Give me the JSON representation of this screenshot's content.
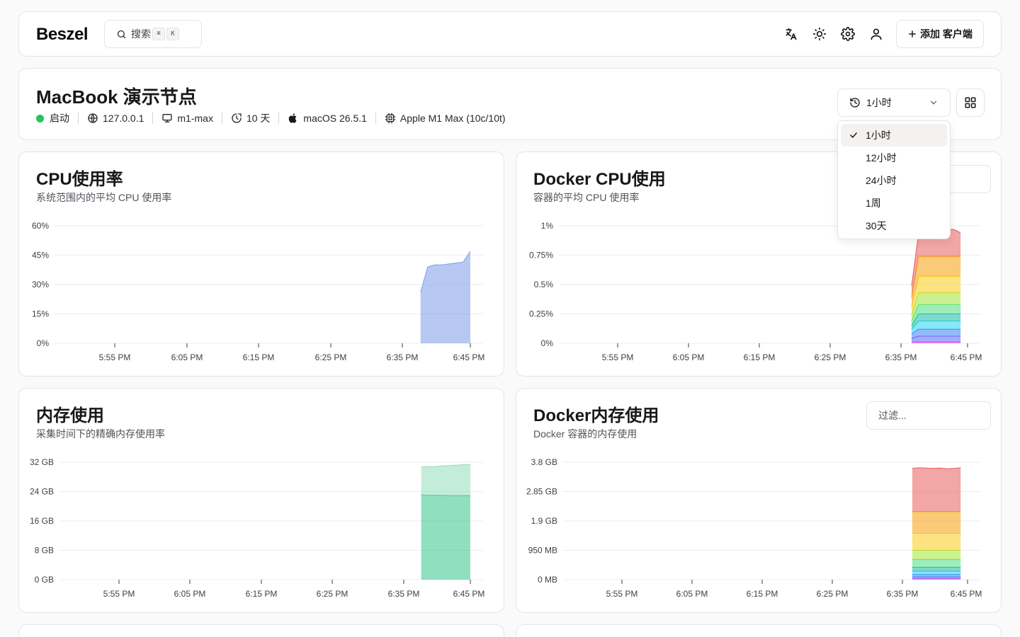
{
  "header": {
    "logo": "Beszel",
    "search_label": "搜索",
    "search_kbd": [
      "⌘",
      "K"
    ],
    "add_client_label": "添加 客户端",
    "icons": [
      "translate-icon",
      "sun-icon",
      "gear-icon",
      "user-icon"
    ]
  },
  "system": {
    "title": "MacBook 演示节点",
    "status": "启动",
    "ip": "127.0.0.1",
    "hostname": "m1-max",
    "uptime": "10 天",
    "os": "macOS 26.5.1",
    "cpu": "Apple M1 Max (10c/10t)",
    "status_color": "#22c55e"
  },
  "time_range": {
    "selected": "1小时",
    "options": [
      "1小时",
      "12小时",
      "24小时",
      "1周",
      "30天"
    ]
  },
  "charts": {
    "cpu": {
      "title": "CPU使用率",
      "subtitle": "系统范围内的平均 CPU 使用率"
    },
    "docker_cpu": {
      "title": "Docker CPU使用",
      "subtitle": "容器的平均 CPU 使用率"
    },
    "memory": {
      "title": "内存使用",
      "subtitle": "采集时间下的精确内存使用率"
    },
    "docker_memory": {
      "title": "Docker内存使用",
      "subtitle": "Docker 容器的内存使用",
      "filter_placeholder": "过滤..."
    }
  },
  "chart_data": [
    {
      "id": "cpu",
      "type": "area",
      "x_ticks": [
        "5:55 PM",
        "6:05 PM",
        "6:15 PM",
        "6:25 PM",
        "6:35 PM",
        "6:45 PM"
      ],
      "y_ticks": [
        "0%",
        "15%",
        "30%",
        "45%",
        "60%"
      ],
      "ylim": [
        0,
        60
      ],
      "x_minutes": [
        43,
        44,
        45,
        46,
        47,
        48,
        49,
        50
      ],
      "series": [
        {
          "color": "#7c9ce8",
          "values": [
            26,
            39,
            40,
            40,
            40.5,
            41,
            41.5,
            47
          ]
        }
      ]
    },
    {
      "id": "docker_cpu",
      "type": "area",
      "stacked": true,
      "x_ticks": [
        "5:55 PM",
        "6:05 PM",
        "6:15 PM",
        "6:25 PM",
        "6:35 PM",
        "6:45 PM"
      ],
      "y_ticks": [
        "0%",
        "0.25%",
        "0.5%",
        "0.75%",
        "1%"
      ],
      "ylim": [
        0,
        1
      ],
      "x_minutes": [
        42,
        43,
        44,
        45,
        46,
        47,
        48,
        49
      ],
      "series": [
        {
          "color": "#d946ef",
          "values": [
            0.01,
            0.01,
            0.01,
            0.01,
            0.01,
            0.01,
            0.01,
            0.01
          ]
        },
        {
          "color": "#6366f1",
          "values": [
            0.03,
            0.05,
            0.05,
            0.05,
            0.05,
            0.05,
            0.05,
            0.05
          ]
        },
        {
          "color": "#3b82f6",
          "values": [
            0.04,
            0.06,
            0.06,
            0.06,
            0.06,
            0.06,
            0.06,
            0.06
          ]
        },
        {
          "color": "#22d3ee",
          "values": [
            0.04,
            0.07,
            0.07,
            0.07,
            0.07,
            0.07,
            0.07,
            0.07
          ]
        },
        {
          "color": "#14b8a6",
          "values": [
            0.03,
            0.06,
            0.06,
            0.06,
            0.06,
            0.06,
            0.06,
            0.06
          ]
        },
        {
          "color": "#4ade80",
          "values": [
            0.04,
            0.08,
            0.08,
            0.08,
            0.08,
            0.08,
            0.08,
            0.08
          ]
        },
        {
          "color": "#a3e635",
          "values": [
            0.05,
            0.1,
            0.1,
            0.1,
            0.1,
            0.1,
            0.1,
            0.1
          ]
        },
        {
          "color": "#facc15",
          "values": [
            0.07,
            0.14,
            0.14,
            0.14,
            0.14,
            0.14,
            0.14,
            0.14
          ]
        },
        {
          "color": "#f59e0b",
          "values": [
            0.08,
            0.17,
            0.17,
            0.17,
            0.17,
            0.17,
            0.17,
            0.17
          ]
        },
        {
          "color": "#e85d5d",
          "values": [
            0.1,
            0.2,
            0.21,
            0.22,
            0.22,
            0.23,
            0.23,
            0.2
          ]
        }
      ]
    },
    {
      "id": "memory",
      "type": "area",
      "stacked": true,
      "x_ticks": [
        "5:55 PM",
        "6:05 PM",
        "6:15 PM",
        "6:25 PM",
        "6:35 PM",
        "6:45 PM"
      ],
      "y_ticks": [
        "0 GB",
        "8 GB",
        "16 GB",
        "24 GB",
        "32 GB"
      ],
      "ylim": [
        0,
        32
      ],
      "x_minutes": [
        43,
        44,
        45,
        46,
        47,
        48,
        49,
        50
      ],
      "series": [
        {
          "color": "#34c48b",
          "values": [
            23.1,
            23.0,
            23.0,
            23.0,
            22.9,
            22.9,
            22.9,
            22.9
          ]
        },
        {
          "color": "#93dcbc",
          "values": [
            7.6,
            7.8,
            7.8,
            8.0,
            8.2,
            8.3,
            8.4,
            8.5
          ]
        }
      ]
    },
    {
      "id": "docker_memory",
      "type": "area",
      "stacked": true,
      "x_ticks": [
        "5:55 PM",
        "6:05 PM",
        "6:15 PM",
        "6:25 PM",
        "6:35 PM",
        "6:45 PM"
      ],
      "y_ticks": [
        "0 MB",
        "950 MB",
        "1.9 GB",
        "2.85 GB",
        "3.8 GB"
      ],
      "ylim": [
        0,
        3800
      ],
      "x_minutes": [
        42,
        43,
        44,
        45,
        46,
        47,
        48,
        49
      ],
      "series": [
        {
          "color": "#d946ef",
          "values": [
            30,
            30,
            30,
            30,
            30,
            30,
            30,
            30
          ]
        },
        {
          "color": "#6366f1",
          "values": [
            60,
            60,
            60,
            60,
            60,
            60,
            60,
            60
          ]
        },
        {
          "color": "#3b82f6",
          "values": [
            80,
            80,
            80,
            80,
            80,
            80,
            80,
            80
          ]
        },
        {
          "color": "#22d3ee",
          "values": [
            100,
            100,
            100,
            100,
            100,
            100,
            100,
            100
          ]
        },
        {
          "color": "#14b8a6",
          "values": [
            130,
            130,
            130,
            130,
            130,
            130,
            130,
            130
          ]
        },
        {
          "color": "#4ade80",
          "values": [
            250,
            250,
            250,
            250,
            250,
            250,
            250,
            250
          ]
        },
        {
          "color": "#a3e635",
          "values": [
            300,
            300,
            300,
            300,
            300,
            300,
            300,
            300
          ]
        },
        {
          "color": "#facc15",
          "values": [
            550,
            550,
            550,
            550,
            550,
            550,
            550,
            550
          ]
        },
        {
          "color": "#f59e0b",
          "values": [
            700,
            700,
            700,
            700,
            700,
            700,
            700,
            700
          ]
        },
        {
          "color": "#e85d5d",
          "values": [
            1400,
            1420,
            1410,
            1400,
            1410,
            1390,
            1400,
            1420
          ]
        }
      ]
    }
  ]
}
